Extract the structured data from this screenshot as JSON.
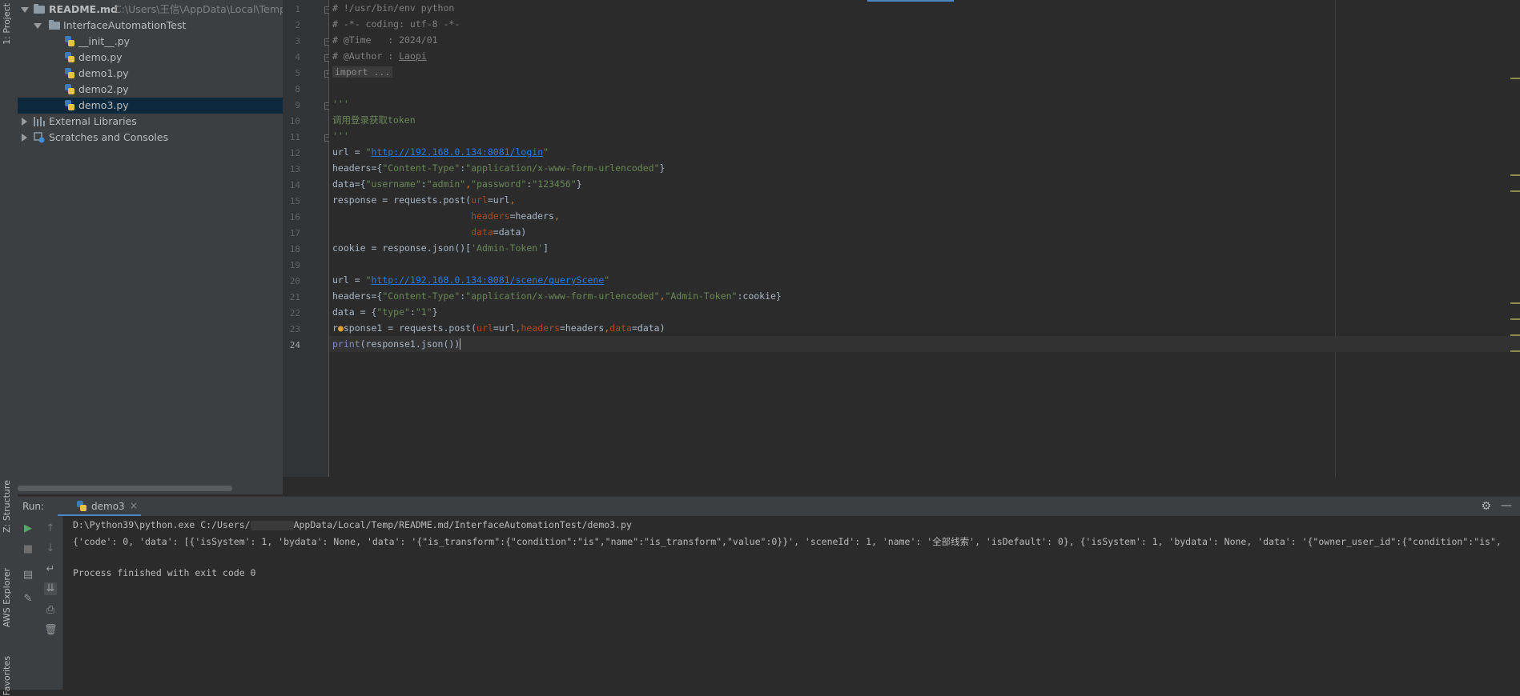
{
  "left_strip": {
    "tabs": [
      "1: Project",
      "Z: Structure",
      "AWS Explorer",
      "Favorites"
    ]
  },
  "project": {
    "root": {
      "name": "README.md",
      "path": "C:\\Users\\王信\\AppData\\Local\\Temp\\"
    },
    "folder": "InterfaceAutomationTest",
    "files": [
      "__init__.py",
      "demo.py",
      "demo1.py",
      "demo2.py",
      "demo3.py"
    ],
    "selected_file": "demo3.py",
    "external_libraries": "External Libraries",
    "scratches": "Scratches and Consoles"
  },
  "editor": {
    "current_line": 24,
    "line_numbers": [
      "1",
      "2",
      "3",
      "4",
      "5",
      "8",
      "9",
      "10",
      "11",
      "12",
      "13",
      "14",
      "15",
      "16",
      "17",
      "18",
      "19",
      "20",
      "21",
      "22",
      "23",
      "24"
    ]
  },
  "run": {
    "label": "Run:",
    "tab": "demo3",
    "command": "D:\\Python39\\python.exe C:/Users/",
    "command_tail": "AppData/Local/Temp/README.md/InterfaceAutomationTest/demo3.py",
    "output": "{'code': 0, 'data': [{'isSystem': 1, 'bydata': None, 'data': '{\"is_transform\":{\"condition\":\"is\",\"name\":\"is_transform\",\"value\":0}}', 'sceneId': 1, 'name': '全部线索', 'isDefault': 0}, {'isSystem': 1, 'bydata': None, 'data': '{\"owner_user_id\":{\"condition\":\"is\",",
    "exit": "Process finished with exit code 0"
  },
  "colors": {
    "comment": "#808080",
    "string": "#6a8759",
    "url": "#287bde",
    "keyword": "#cc7832",
    "param": "#aa4926",
    "selection": "#0d293e"
  }
}
